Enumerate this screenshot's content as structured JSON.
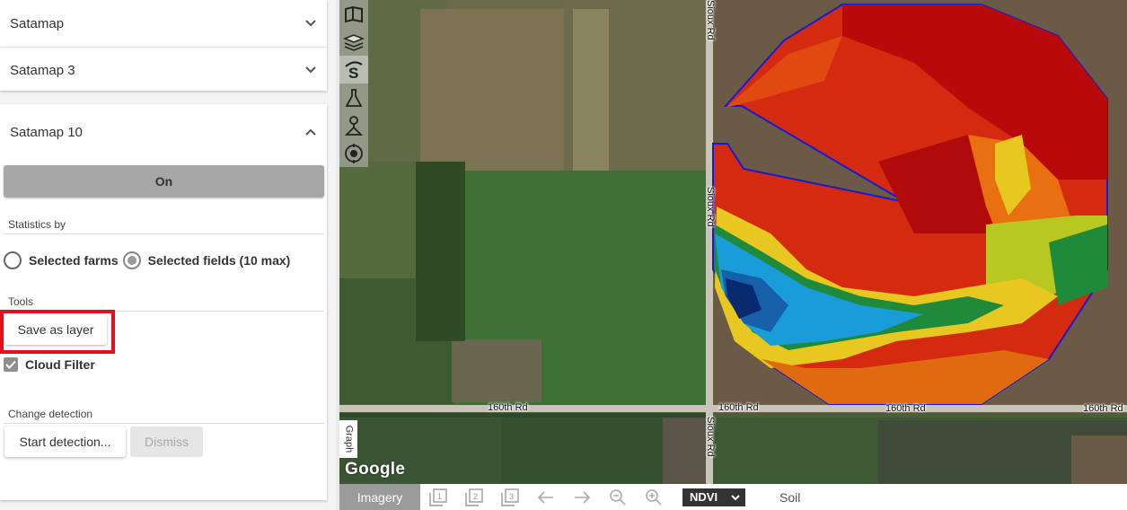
{
  "accordions": [
    {
      "title": "Satamap",
      "expanded": false
    },
    {
      "title": "Satamap 3",
      "expanded": false
    },
    {
      "title": "Satamap 10",
      "expanded": true
    }
  ],
  "panel": {
    "on_label": "On",
    "statistics_label": "Statistics by",
    "radio_options": [
      {
        "label": "Selected farms",
        "selected": false
      },
      {
        "label": "Selected fields (10 max)",
        "selected": true
      }
    ],
    "tools_label": "Tools",
    "save_layer_label": "Save as layer",
    "cloud_filter_label": "Cloud Filter",
    "cloud_filter_checked": true,
    "change_detection_label": "Change detection",
    "start_detection_label": "Start detection...",
    "dismiss_label": "Dismiss"
  },
  "map": {
    "road_labels": {
      "sioux_top": "Sioux Rd",
      "sioux_mid": "Sioux Rd",
      "sioux_bottom": "Sioux Rd",
      "r160_left": "160th Rd",
      "r160_mid": "160th Rd",
      "r160_mid2": "160th Rd",
      "r160_right": "160th Rd"
    },
    "graph_tab": "Graph",
    "logo": "Google",
    "tool_icons": [
      "map-book-icon",
      "layers-icon",
      "satamap-s-icon",
      "lab-flask-icon",
      "field-marker-icon",
      "target-scan-icon"
    ],
    "accent_color": "#e0101e",
    "field_outline_color": "#1a1ad0"
  },
  "bottombar": {
    "imagery_label": "Imagery",
    "icons": [
      "layout-1-icon",
      "layout-2-icon",
      "layout-3-icon",
      "arrow-left-icon",
      "arrow-right-icon",
      "zoom-out-icon",
      "zoom-in-icon"
    ],
    "ndvi_label": "NDVI",
    "soil_label": "Soil"
  }
}
